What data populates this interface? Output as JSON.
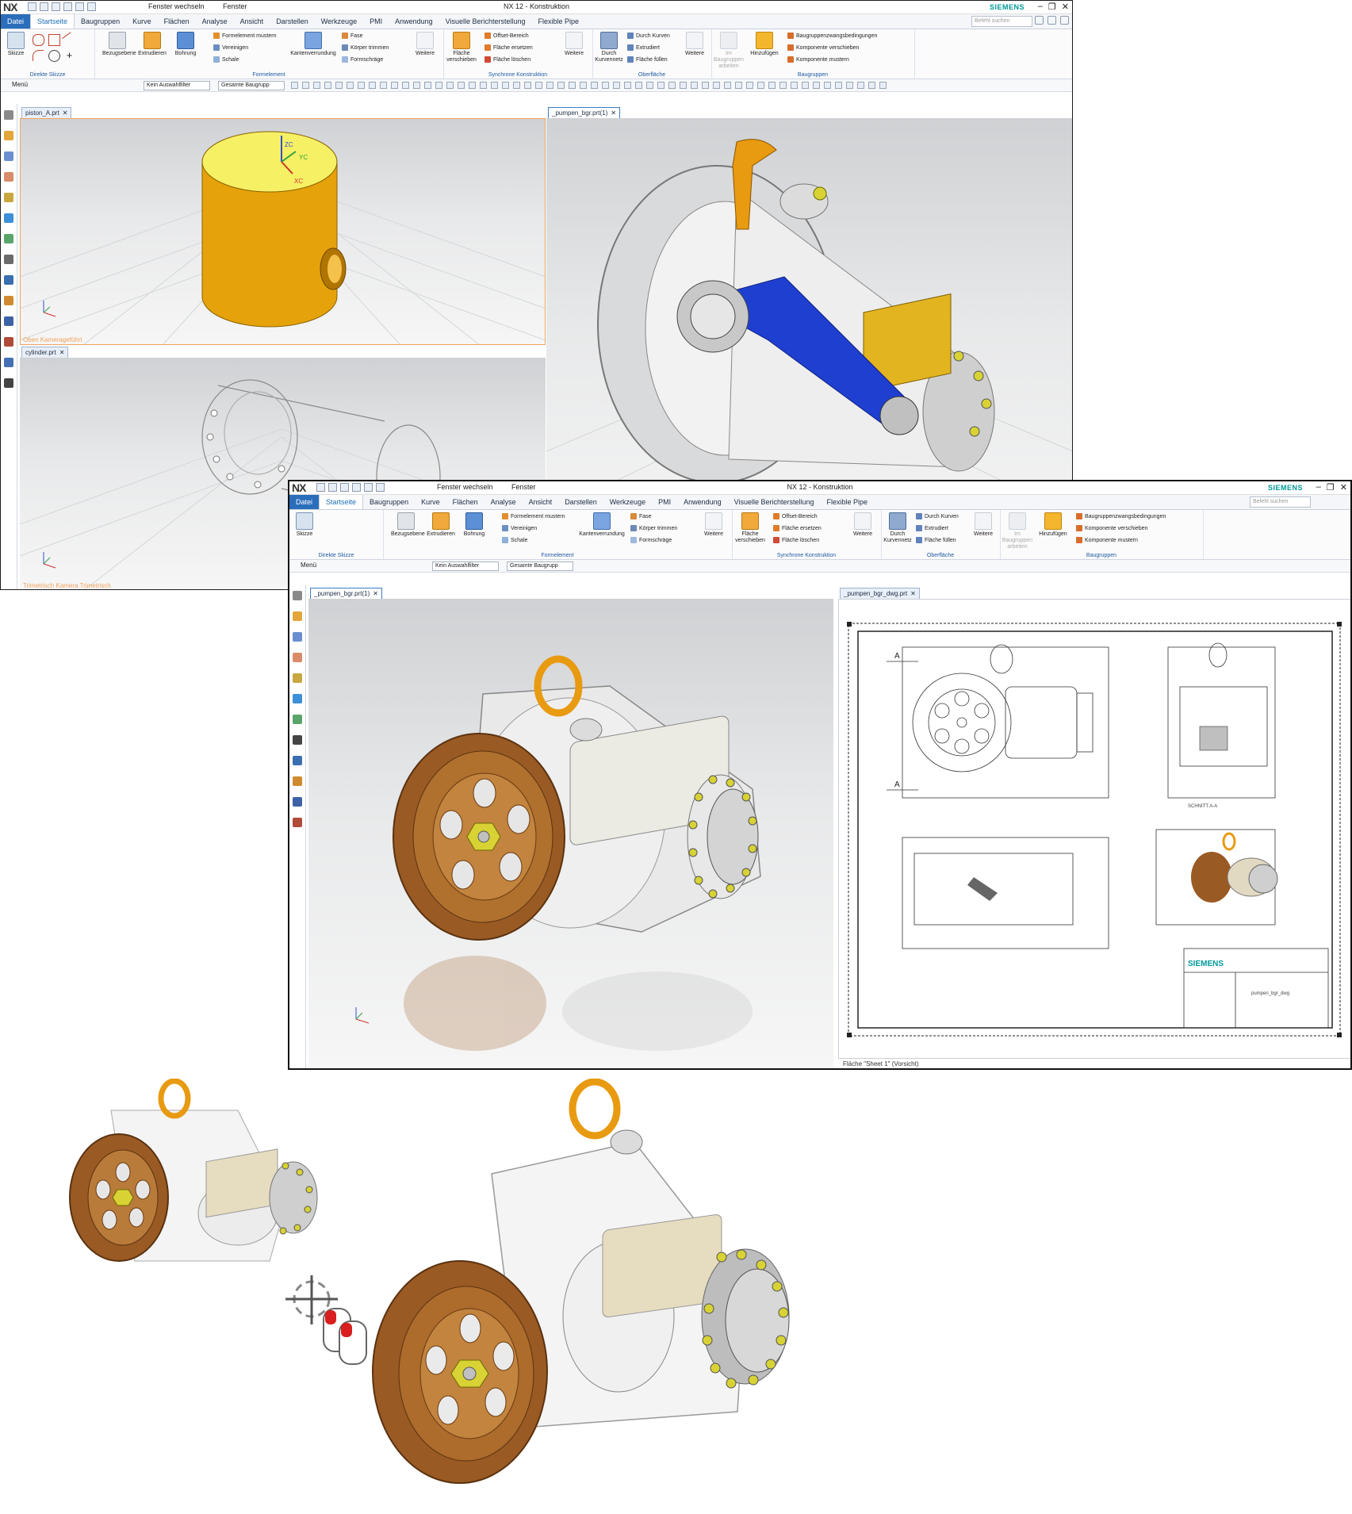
{
  "window1": {
    "title": "NX 12 - Konstruktion",
    "logo": "NX",
    "brand": "SIEMENS",
    "qat_window_switch": "Fenster wechseln",
    "qat_window_menu": "Fenster",
    "search_placeholder": "Befehl suchen",
    "tabs": [
      "Datei",
      "Startseite",
      "Baugruppen",
      "Kurve",
      "Flächen",
      "Analyse",
      "Ansicht",
      "Darstellen",
      "Werkzeuge",
      "PMI",
      "Anwendung",
      "Visuelle Berichterstellung",
      "Flexible Pipe"
    ],
    "ribbon": {
      "sketch": "Skizze",
      "direct_sketch": "Direkte Skizze",
      "datum_plane": "Bezugsebene",
      "extrude": "Extrudieren",
      "hole": "Bohrung",
      "pattern_feature": "Formelement mustern",
      "unite": "Vereinigen",
      "shell": "Schale",
      "edge_blend": "Kantenverrundung",
      "chamfer": "Fase",
      "trim_body": "Körper trimmen",
      "draft": "Formschräge",
      "more": "Weitere",
      "feature_group": "Formelement",
      "move_face": "Fläche verschieben",
      "offset_region": "Offset-Bereich",
      "replace_face": "Fläche ersetzen",
      "delete_face": "Fläche löschen",
      "sync_group": "Synchrone Konstruktion",
      "through_curves": "Durch Kurven",
      "extruded": "Extrudiert",
      "fill_surface": "Fläche füllen",
      "through_curve_mesh": "Durch Kurvennetz",
      "surface_group": "Oberfläche",
      "work_in_assembly": "Im Baugruppen arbeiten",
      "add": "Hinzufügen",
      "assembly_constraints": "Baugruppenzwangsbedingungen",
      "move_component": "Komponente verschieben",
      "pattern_component": "Komponente mustern",
      "assembly_group": "Baugruppen"
    },
    "toolbar": {
      "menu": "Menü",
      "selection_filter": "Kein Auswahlfilter",
      "scope": "Gesamte Baugrupp"
    },
    "views": [
      {
        "tab": "piston_A.prt",
        "caption": "Oben Kamerageführt"
      },
      {
        "tab": "_pumpen_bgr.prt(1)",
        "caption": ""
      },
      {
        "tab": "cylinder.prt",
        "caption": "Trimetrisch Kamera Trimetrisch"
      }
    ],
    "axes": {
      "zc": "ZC",
      "yc": "YC",
      "xc": "XC"
    }
  },
  "window2": {
    "title": "NX 12 - Konstruktion",
    "logo": "NX",
    "brand": "SIEMENS",
    "views": [
      {
        "tab": "_pumpen_bgr.prt(1)"
      },
      {
        "tab": "_pumpen_bgr_dwg.prt"
      }
    ],
    "drawing": {
      "section_label": "A",
      "section_caption": "SCHNITT A-A",
      "title_brand": "SIEMENS",
      "title_part": "pumpen_bgr_dwg",
      "status": "Fläche \"Sheet 1\" (Vorsicht)"
    }
  },
  "colors": {
    "accent": "#2a6ebb",
    "brand": "#009999",
    "selection": "#f0a35e",
    "gold": "#e8b000",
    "bronze": "#9a5a24",
    "blue_rod": "#1f3fd0"
  },
  "icons": [
    "sketch-icon",
    "extrude-icon",
    "hole-icon",
    "chamfer-icon",
    "rotate-cursor-icon",
    "mouse-icon"
  ]
}
